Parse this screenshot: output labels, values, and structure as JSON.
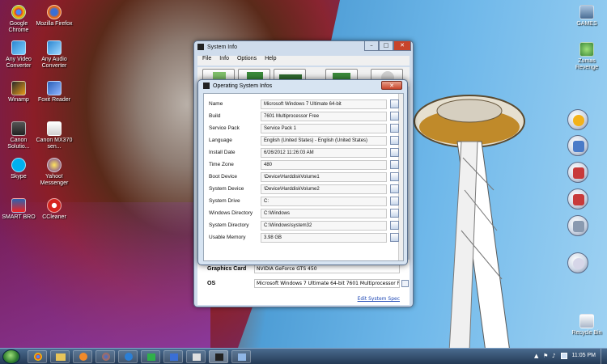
{
  "desktop_icons": [
    {
      "label": "Google Chrome",
      "color": "#d8322c"
    },
    {
      "label": "Mozilla Firefox",
      "color": "#e86a17"
    },
    {
      "label": "Any Video Converter",
      "color": "#2b86d1"
    },
    {
      "label": "Any Audio Converter",
      "color": "#2b86d1"
    },
    {
      "label": "Winamp",
      "color": "#e89b1a"
    },
    {
      "label": "Foxit Reader",
      "color": "#2a5fb8"
    },
    {
      "label": "Canon Solutio...",
      "color": "#333333"
    },
    {
      "label": "Canon MX370 sen...",
      "color": "#ffffff"
    },
    {
      "label": "Skype",
      "color": "#00aff0"
    },
    {
      "label": "Yahoo! Messenger",
      "color": "#6b3fa0"
    },
    {
      "label": "SMART BRO",
      "color": "#2b62b0"
    },
    {
      "label": "CCleaner",
      "color": "#d6241f"
    },
    {
      "label": "GAMES",
      "color": "#7aa0c8"
    },
    {
      "label": "Zumas Revenge",
      "color": "#3d8a3a"
    },
    {
      "label": "Recycle Bin",
      "color": "#cfd8e6"
    }
  ],
  "sysinfo": {
    "title": "System Info",
    "minimize": "–",
    "maximize": "□",
    "close": "✕",
    "menu": [
      "File",
      "Info",
      "Options",
      "Help"
    ],
    "graphics_label": "Graphics Card",
    "graphics_value": "NVIDIA GeForce GTS 450",
    "os_label": "OS",
    "os_value": "Microsoft Windows 7 Ultimate  64-bit 7601 Multiprocessor F",
    "edit_link": "Edit System Spec"
  },
  "osdialog": {
    "title": "Operating System Infos",
    "close": "✕",
    "rows": [
      {
        "label": "Name",
        "value": "Microsoft Windows 7 Ultimate  64-bit"
      },
      {
        "label": "Build",
        "value": "7601 Multiprocessor Free"
      },
      {
        "label": "Service Pack",
        "value": "Service Pack 1"
      },
      {
        "label": "Language",
        "value": "English (United States) - English (United States)"
      },
      {
        "label": "Install Date",
        "value": "6/26/2012 11:26:03 AM"
      },
      {
        "label": "Time Zone",
        "value": "480"
      },
      {
        "label": "Boot Device",
        "value": "\\Device\\HarddiskVolume1"
      },
      {
        "label": "System Device",
        "value": "\\Device\\HarddiskVolume2"
      },
      {
        "label": "System Drive",
        "value": "C:"
      },
      {
        "label": "Windows Directory",
        "value": "C:\\Windows"
      },
      {
        "label": "System Directory",
        "value": "C:\\Windows\\system32"
      },
      {
        "label": "Usable Memory",
        "value": "3.98 GB"
      }
    ]
  },
  "taskbar": {
    "clock": "11:05 PM",
    "tray_arrow": "▲",
    "tray_flag": "⚑",
    "tray_speaker": "♪"
  }
}
